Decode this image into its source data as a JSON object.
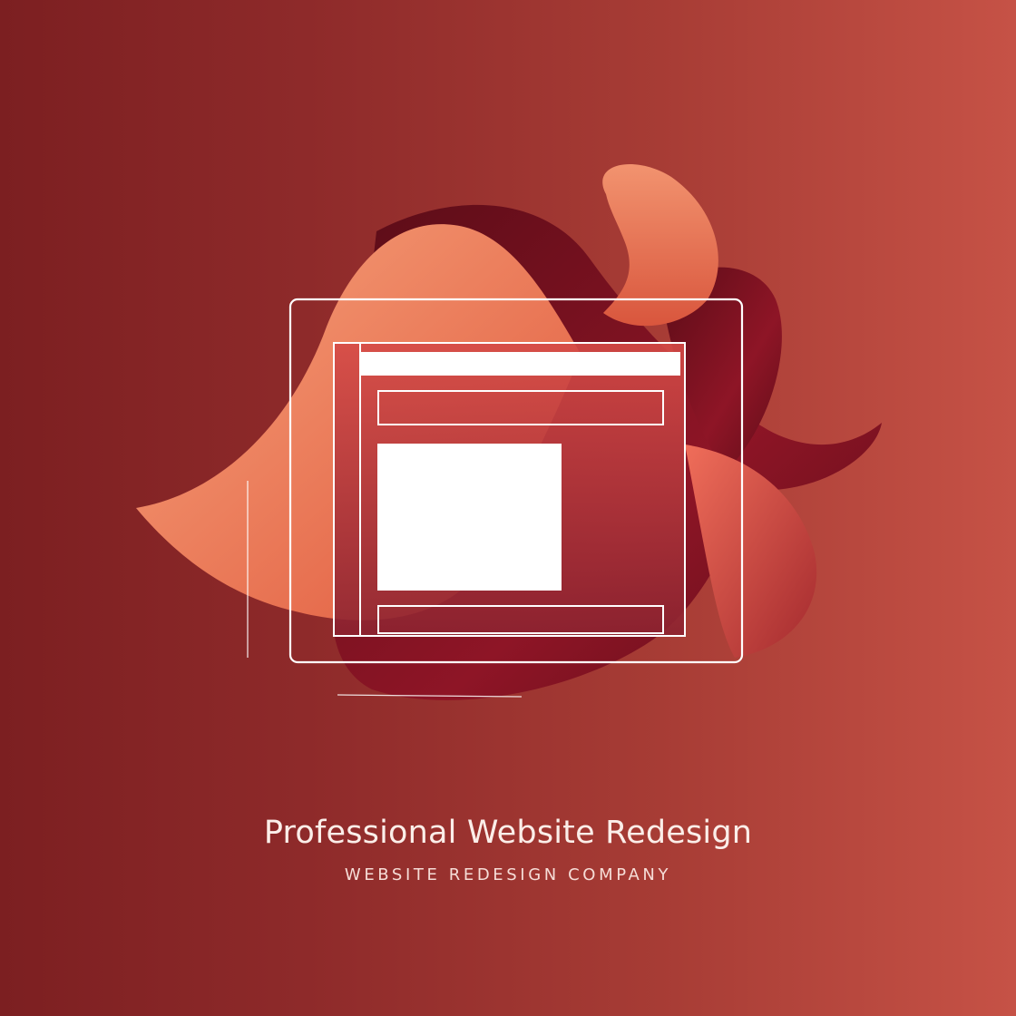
{
  "colors": {
    "background_left": "#7c1f21",
    "background_right": "#c65246",
    "shape_peach": "#ec8a68",
    "shape_maroon": "#6e0f1c",
    "frame_line": "#ffffff",
    "text": "#fbeee9"
  },
  "icons": {
    "main": "website-window-icon",
    "decor": "abstract-ribbon-shapes"
  },
  "branding": {
    "title": "Professional Website Redesign",
    "subtitle": "WEBSITE REDESIGN COMPANY"
  }
}
